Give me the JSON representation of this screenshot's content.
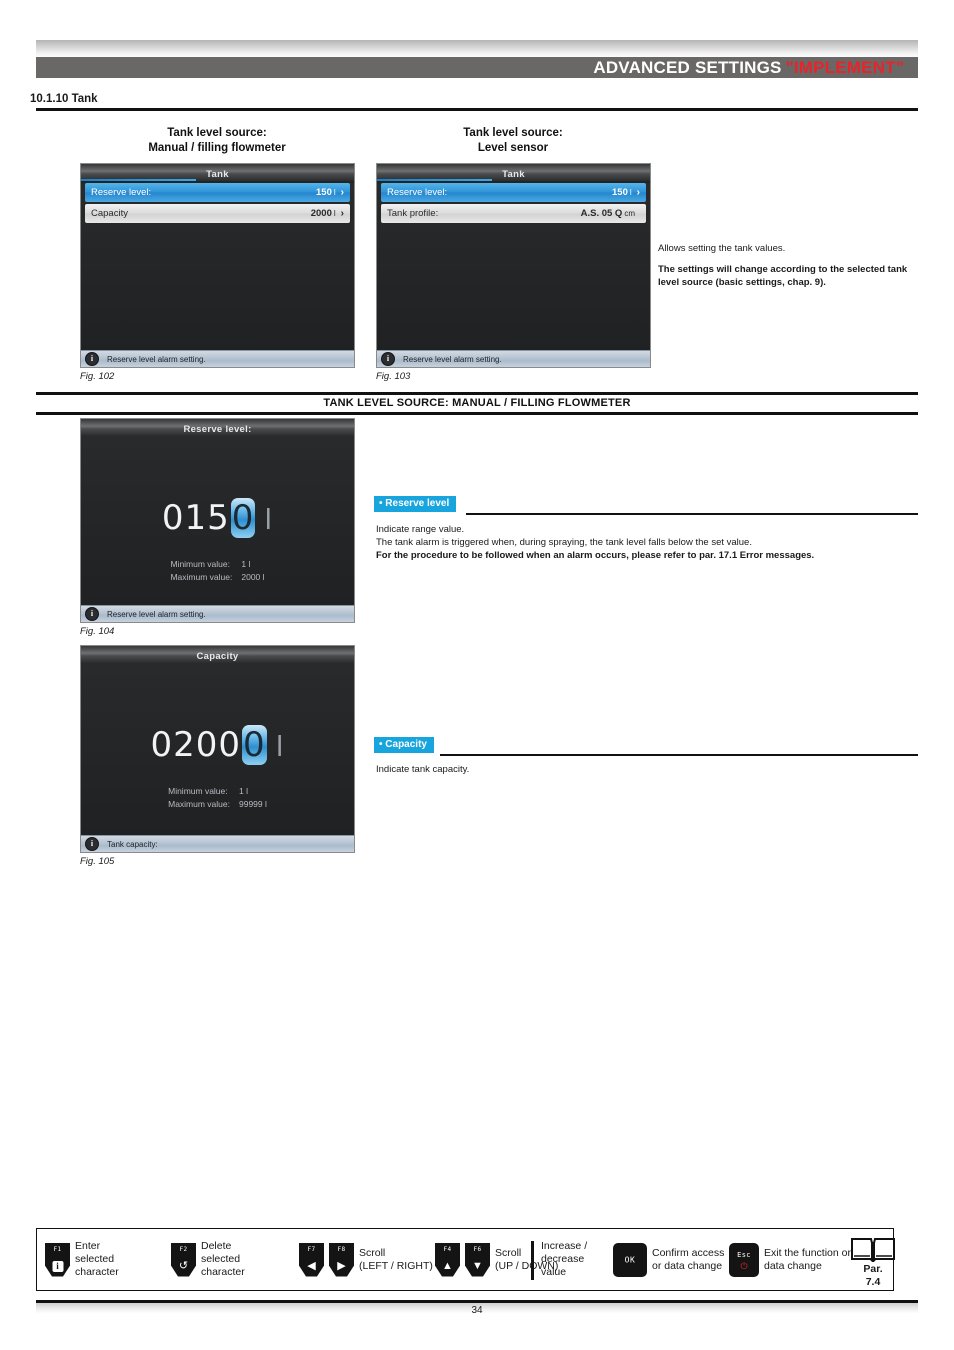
{
  "header": {
    "title_main": "ADVANCED SETTINGS",
    "title_accent": "\"IMPLEMENT\"",
    "accent_color": "#e8232a"
  },
  "section": {
    "number_title": "10.1.10 Tank"
  },
  "figures": {
    "fig102": {
      "column_title_line1": "Tank level source:",
      "column_title_line2": "Manual / filling flowmeter",
      "screen_title": "Tank",
      "rows": [
        {
          "label": "Reserve level:",
          "value": "150",
          "unit": "l",
          "chevron": "›",
          "selected": true
        },
        {
          "label": "Capacity",
          "value": "2000",
          "unit": "l",
          "chevron": "›",
          "selected": false
        }
      ],
      "status_bar": "Reserve level alarm setting.",
      "caption": "Fig. 102"
    },
    "fig103": {
      "column_title_line1": "Tank level source:",
      "column_title_line2": "Level sensor",
      "screen_title": "Tank",
      "rows": [
        {
          "label": "Reserve level:",
          "value": "150",
          "unit": "l",
          "chevron": "›",
          "selected": true
        },
        {
          "label": "Tank profile:",
          "value": "A.S. 05 Q",
          "unit": "cm",
          "chevron": "",
          "selected": false
        }
      ],
      "status_bar": "Reserve level alarm setting.",
      "caption": "Fig. 103"
    },
    "fig104": {
      "screen_title": "Reserve level:",
      "value_prefix": "015",
      "value_cursor": "0",
      "value_unit": "l",
      "minimum_label": "Minimum value:",
      "minimum_value": "1 l",
      "maximum_label": "Maximum value:",
      "maximum_value": "2000 l",
      "status_bar": "Reserve level alarm setting.",
      "caption": "Fig. 104"
    },
    "fig105": {
      "screen_title": "Capacity",
      "value_prefix": "0200",
      "value_cursor": "0",
      "value_unit": "l",
      "minimum_label": "Minimum value:",
      "minimum_value": "1 l",
      "maximum_label": "Maximum value:",
      "maximum_value": "99999 l",
      "status_bar": "Tank capacity:",
      "caption": "Fig. 105"
    }
  },
  "intro_text": {
    "line1": "Allows setting the tank values.",
    "note": "The settings will change according to the selected tank level source (basic settings, chap. 9)."
  },
  "divider": {
    "title": "TANK LEVEL SOURCE: MANUAL / FILLING FLOWMETER"
  },
  "reserve_level_section": {
    "label": "• Reserve level",
    "line1": "Indicate range value.",
    "line2": "The tank alarm is triggered when, during spraying, the tank level falls below the set value.",
    "line3_bold": "For the procedure to be followed when an alarm occurs, please refer to par. 17.1 Error messages."
  },
  "capacity_section": {
    "label": "• Capacity",
    "line1": "Indicate tank capacity."
  },
  "legend": {
    "items": [
      {
        "keys": [
          {
            "fnum": "F1",
            "glyph": "i",
            "type": "ibox"
          }
        ],
        "text": "Enter\nselected\ncharacter"
      },
      {
        "keys": [
          {
            "fnum": "F2",
            "glyph": "↺",
            "type": "glyph"
          }
        ],
        "text": "Delete\nselected\ncharacter"
      },
      {
        "keys": [
          {
            "fnum": "F7",
            "glyph": "◀",
            "type": "glyph"
          },
          {
            "fnum": "F8",
            "glyph": "▶",
            "type": "glyph"
          }
        ],
        "text": "Scroll\n(LEFT / RIGHT)"
      },
      {
        "keys": [
          {
            "fnum": "F4",
            "glyph": "▲",
            "type": "glyph"
          },
          {
            "fnum": "F6",
            "glyph": "▼",
            "type": "glyph"
          }
        ],
        "text": "Scroll\n(UP / DOWN)"
      },
      {
        "keys": [],
        "text": "Increase /\ndecrease\nvalue"
      },
      {
        "keys": [
          {
            "fnum": "",
            "glyph": "OK",
            "type": "ok"
          }
        ],
        "text": "Confirm access\nor data change"
      },
      {
        "keys": [
          {
            "fnum": "Esc",
            "glyph": "⭢",
            "type": "esc"
          }
        ],
        "text": "Exit the function or\ndata change"
      }
    ],
    "par_line1": "Par.",
    "par_line2": "7.4"
  },
  "footer": {
    "page_number": "34"
  }
}
